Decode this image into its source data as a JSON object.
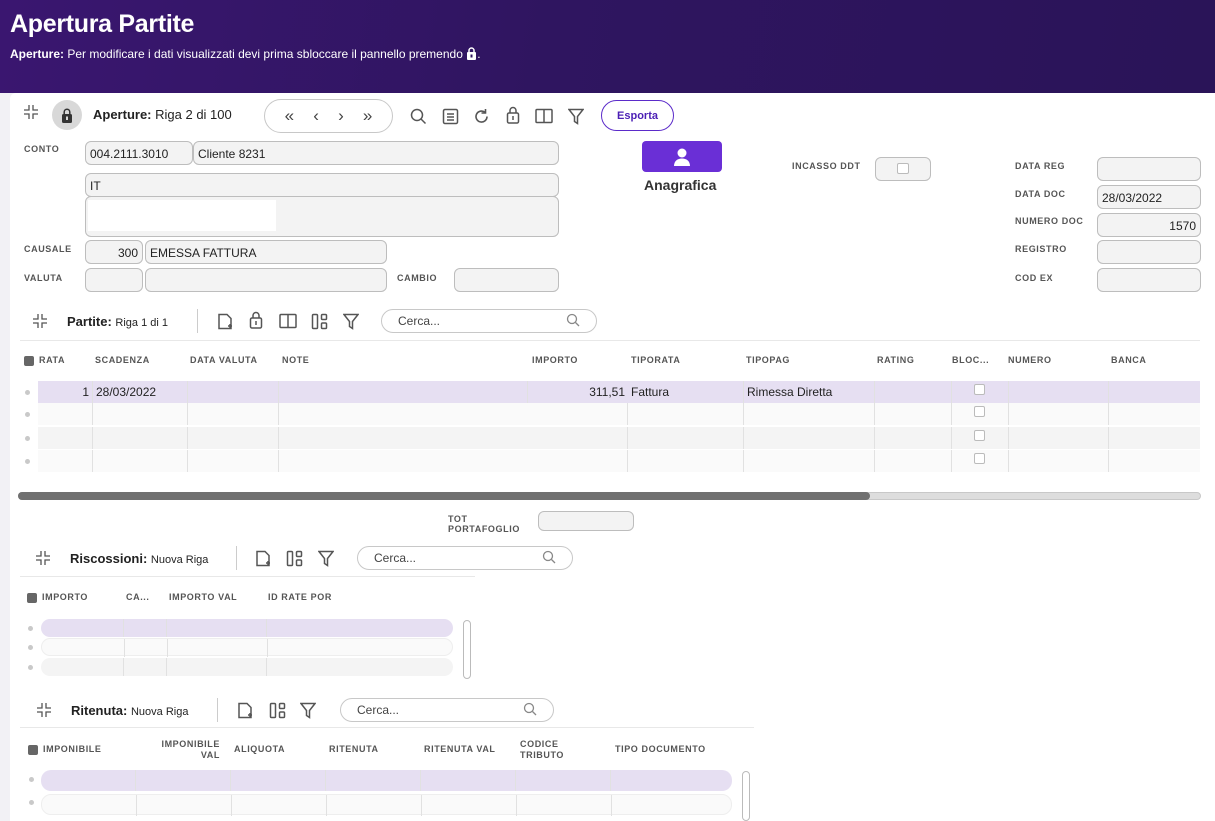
{
  "header": {
    "title": "Apertura Partite",
    "notice_strong": "Aperture:",
    "notice_text": " Per modificare i dati visualizzati devi prima sbloccare il pannello premendo ",
    "notice_end": "."
  },
  "toolbar": {
    "section_label": "Aperture:",
    "record_info": "Riga 2 di 100",
    "nav_first": "«",
    "nav_prev": "‹",
    "nav_next": "›",
    "nav_last": "»",
    "export_label": "Esporta"
  },
  "form": {
    "conto_label": "CONTO",
    "conto_code": "004.2111.3010",
    "conto_name": "Cliente 8231",
    "country": "IT",
    "anagrafica_label": "Anagrafica",
    "causale_label": "CAUSALE",
    "causale_code": "300",
    "causale_desc": "EMESSA FATTURA",
    "valuta_label": "VALUTA",
    "valuta_code": "",
    "valuta_desc": "",
    "cambio_label": "CAMBIO",
    "cambio_value": "",
    "incasso_ddt_label": "INCASSO DDT",
    "data_reg_label": "DATA REG",
    "data_reg": "",
    "data_doc_label": "DATA DOC",
    "data_doc": "28/03/2022",
    "numero_doc_label": "NUMERO DOC",
    "numero_doc": "1570",
    "registro_label": "REGISTRO",
    "registro": "",
    "cod_ex_label": "COD EX",
    "cod_ex": ""
  },
  "partite": {
    "title": "Partite:",
    "info": "Riga 1 di 1",
    "search_placeholder": "Cerca...",
    "columns": [
      "RATA",
      "SCADENZA",
      "DATA VALUTA",
      "NOTE",
      "IMPORTO",
      "TIPORATA",
      "TIPOPAG",
      "RATING",
      "BLOC...",
      "NUMERO",
      "BANCA"
    ],
    "rows": [
      {
        "rata": "1",
        "scadenza": "28/03/2022",
        "data_valuta": "",
        "note": "",
        "importo": "311,51",
        "tiporata": "Fattura",
        "tipopag": "Rimessa Diretta",
        "rating": "",
        "numero": "",
        "banca": ""
      },
      {
        "rata": "",
        "scadenza": "",
        "data_valuta": "",
        "note": "",
        "importo": "",
        "tiporata": "",
        "tipopag": "",
        "rating": "",
        "numero": "",
        "banca": ""
      },
      {
        "rata": "",
        "scadenza": "",
        "data_valuta": "",
        "note": "",
        "importo": "",
        "tiporata": "",
        "tipopag": "",
        "rating": "",
        "numero": "",
        "banca": ""
      },
      {
        "rata": "",
        "scadenza": "",
        "data_valuta": "",
        "note": "",
        "importo": "",
        "tiporata": "",
        "tipopag": "",
        "rating": "",
        "numero": "",
        "banca": ""
      }
    ],
    "tot_label_1": "TOT",
    "tot_label_2": "PORTAFOGLIO",
    "tot_value": ""
  },
  "riscossioni": {
    "title": "Riscossioni:",
    "info": "Nuova Riga",
    "search_placeholder": "Cerca...",
    "columns": [
      "IMPORTO",
      "CA...",
      "IMPORTO VAL",
      "ID RATE POR"
    ]
  },
  "ritenuta": {
    "title": "Ritenuta:",
    "info": "Nuova Riga",
    "search_placeholder": "Cerca...",
    "columns": [
      "IMPONIBILE",
      "IMPONIBILE",
      "VAL",
      "ALIQUOTA",
      "RITENUTA",
      "RITENUTA VAL",
      "CODICE",
      "TRIBUTO",
      "TIPO DOCUMENTO"
    ]
  },
  "colors": {
    "accent": "#6a2fd6",
    "header_bg": "#2f1560",
    "selected_row": "#e6dff2"
  }
}
